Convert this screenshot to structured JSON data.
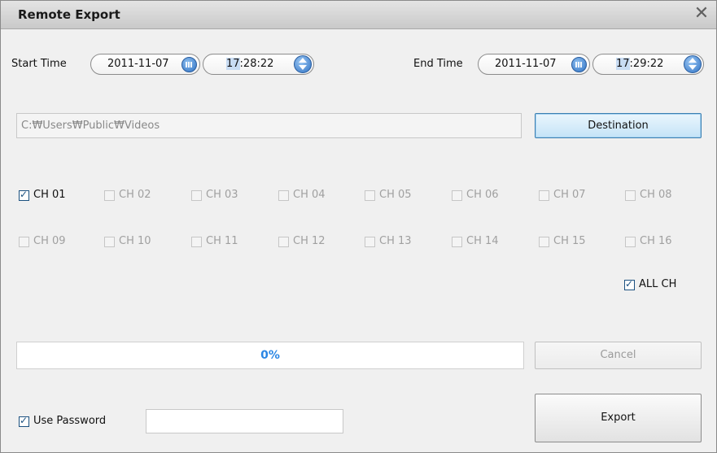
{
  "window": {
    "title": "Remote Export",
    "close_icon": "close-icon"
  },
  "time": {
    "start_label": "Start Time",
    "start_date": "2011-11-07",
    "start_time_hh": "17",
    "start_time_rest": ":28:22",
    "end_label": "End Time",
    "end_date": "2011-11-07",
    "end_time_hh": "17",
    "end_time_rest": ":29:22"
  },
  "destination": {
    "path": "C:\\Users\\Public\\Videos",
    "path_display": "C:₩Users₩Public₩Videos",
    "button_label": "Destination"
  },
  "channels": [
    {
      "label": "CH 01",
      "checked": true,
      "enabled": true
    },
    {
      "label": "CH 02",
      "checked": false,
      "enabled": false
    },
    {
      "label": "CH 03",
      "checked": false,
      "enabled": false
    },
    {
      "label": "CH 04",
      "checked": false,
      "enabled": false
    },
    {
      "label": "CH 05",
      "checked": false,
      "enabled": false
    },
    {
      "label": "CH 06",
      "checked": false,
      "enabled": false
    },
    {
      "label": "CH 07",
      "checked": false,
      "enabled": false
    },
    {
      "label": "CH 08",
      "checked": false,
      "enabled": false
    },
    {
      "label": "CH 09",
      "checked": false,
      "enabled": false
    },
    {
      "label": "CH 10",
      "checked": false,
      "enabled": false
    },
    {
      "label": "CH 11",
      "checked": false,
      "enabled": false
    },
    {
      "label": "CH 12",
      "checked": false,
      "enabled": false
    },
    {
      "label": "CH 13",
      "checked": false,
      "enabled": false
    },
    {
      "label": "CH 14",
      "checked": false,
      "enabled": false
    },
    {
      "label": "CH 15",
      "checked": false,
      "enabled": false
    },
    {
      "label": "CH 16",
      "checked": false,
      "enabled": false
    }
  ],
  "all_ch": {
    "label": "ALL CH",
    "checked": true
  },
  "progress": {
    "value": 0,
    "text": "0%"
  },
  "buttons": {
    "cancel_label": "Cancel",
    "export_label": "Export"
  },
  "password": {
    "label": "Use Password",
    "checked": true,
    "value": ""
  },
  "colors": {
    "accent": "#2a86e4",
    "titlebar": "#d6d6d6",
    "background": "#f0f0f0"
  }
}
